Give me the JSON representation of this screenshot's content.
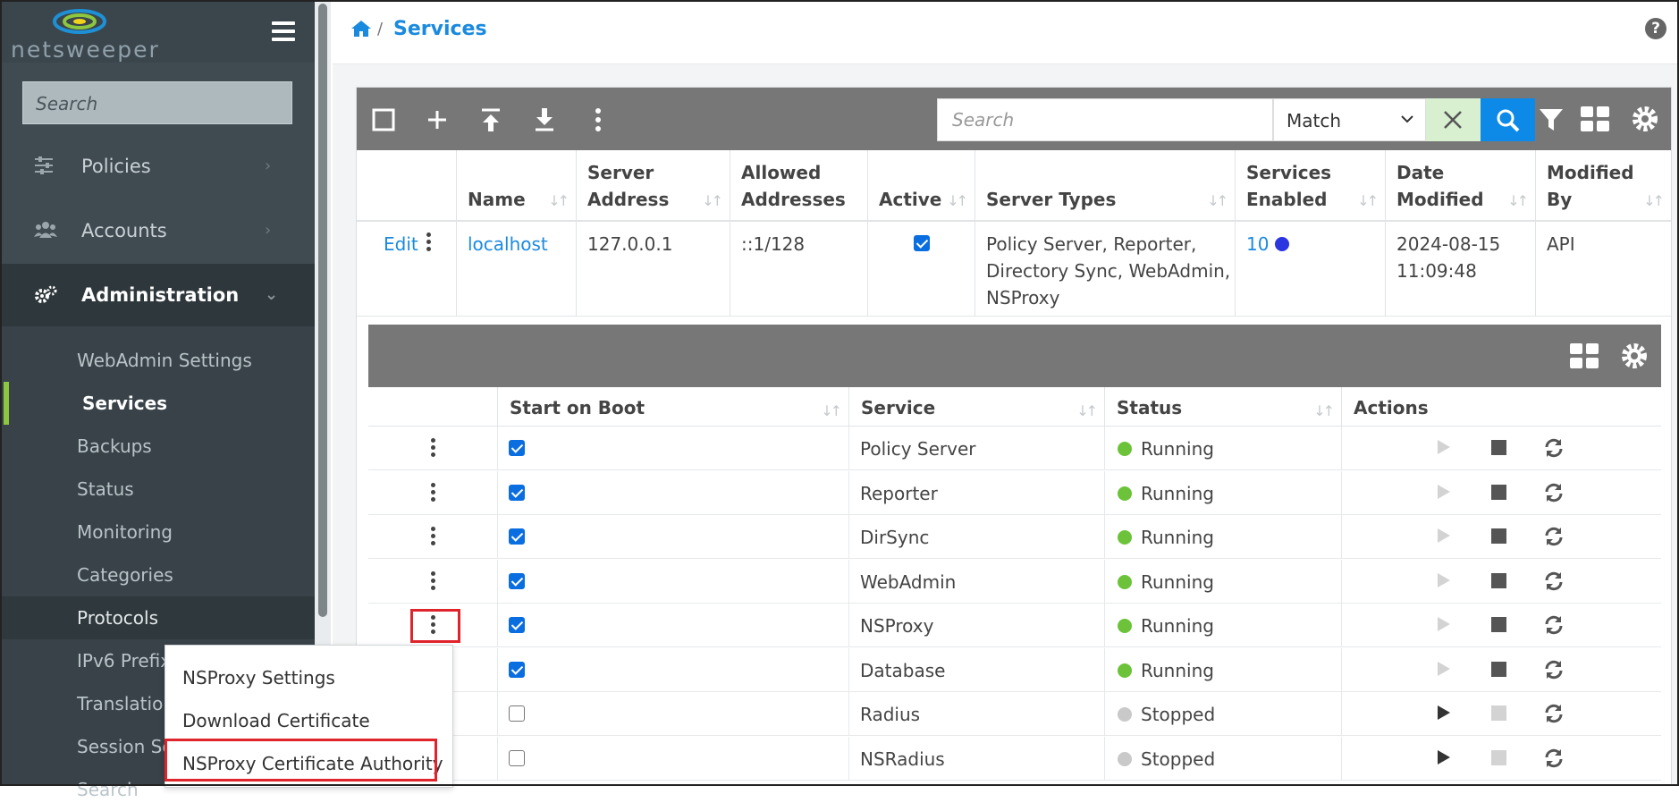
{
  "brand": {
    "logo_text": "netsweeper"
  },
  "sidebar": {
    "search_placeholder": "Search",
    "nav": [
      {
        "label": "Policies",
        "icon": "sliders-icon"
      },
      {
        "label": "Accounts",
        "icon": "users-icon"
      },
      {
        "label": "Administration",
        "icon": "cogs-icon"
      }
    ],
    "submenu": [
      "WebAdmin Settings",
      "Services",
      "Backups",
      "Status",
      "Monitoring",
      "Categories",
      "Protocols",
      "IPv6 Prefix",
      "Translation",
      "Session Se",
      "Search"
    ]
  },
  "breadcrumb": {
    "current": "Services"
  },
  "help": "?",
  "toolbar": {
    "search_placeholder": "Search",
    "match_value": "Match"
  },
  "servers_table": {
    "columns": [
      "Name",
      "Server Address",
      "Allowed Addresses",
      "Active",
      "Server Types",
      "Services Enabled",
      "Date Modified",
      "Modified By"
    ],
    "row": {
      "edit": "Edit",
      "name": "localhost",
      "address": "127.0.0.1",
      "allowed": "::1/128",
      "server_types_lines": [
        "Policy Server, Reporter,",
        "Directory Sync, WebAdmin,",
        "NSProxy"
      ],
      "services_enabled": "10",
      "date_lines": [
        "2024-08-15",
        "11:09:48"
      ],
      "modified_by": "API"
    }
  },
  "services_table": {
    "columns": [
      "Start on Boot",
      "Service",
      "Status",
      "Actions"
    ],
    "rows": [
      {
        "service": "Policy Server",
        "status": "Running"
      },
      {
        "service": "Reporter",
        "status": "Running"
      },
      {
        "service": "DirSync",
        "status": "Running"
      },
      {
        "service": "WebAdmin",
        "status": "Running"
      },
      {
        "service": "NSProxy",
        "status": "Running"
      },
      {
        "service": "Database",
        "status": "Running"
      },
      {
        "service": "Radius",
        "status": "Stopped"
      },
      {
        "service": "NSRadius",
        "status": "Stopped"
      }
    ]
  },
  "context_menu": [
    "NSProxy Settings",
    "Download Certificate",
    "NSProxy Certificate Authority"
  ],
  "colors": {
    "accent": "#1a8adf",
    "running": "#6cc33a",
    "stopped": "#c9c9c9",
    "highlight": "#e0242b",
    "sidebar": "#3f4a51",
    "active_bar": "#8dc63f"
  }
}
